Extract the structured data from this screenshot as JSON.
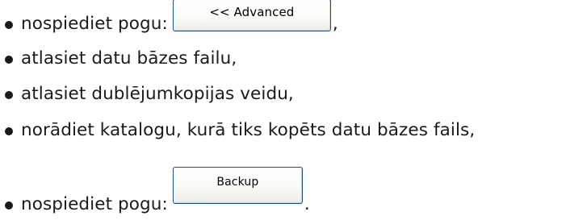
{
  "steps": [
    {
      "text": "nospiediet pogu:",
      "button": "<< Advanced",
      "trail": ","
    },
    {
      "text": "atlasiet datu bāzes failu,"
    },
    {
      "text": "atlasiet dublējumkopijas veidu,"
    },
    {
      "text": "norādiet katalogu, kurā tiks kopēts datu bāzes fails,"
    },
    {
      "text": "nospiediet pogu:",
      "button": "Backup",
      "trail": "."
    }
  ]
}
